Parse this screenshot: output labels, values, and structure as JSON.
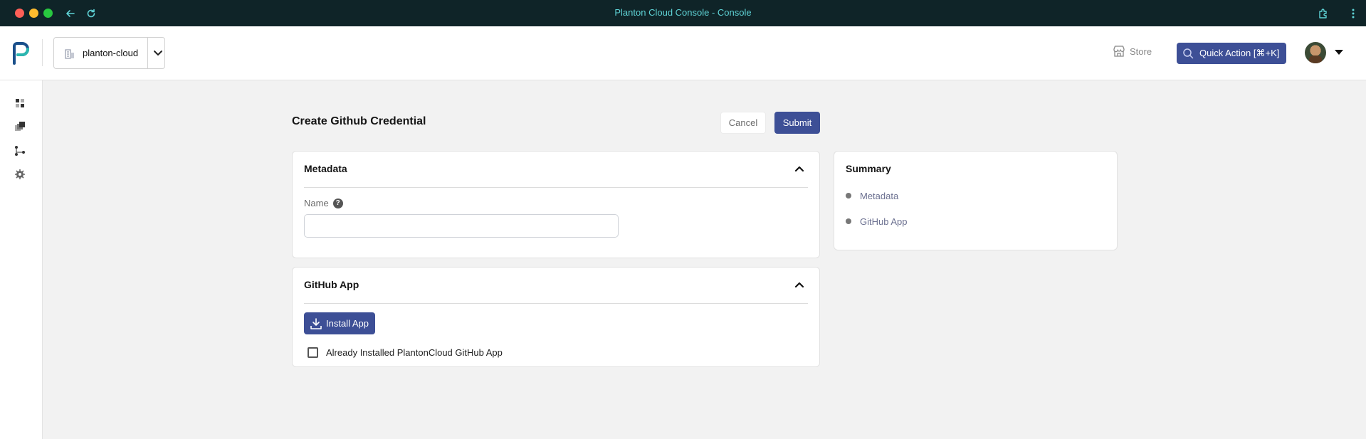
{
  "window": {
    "title": "Planton Cloud Console - Console"
  },
  "header": {
    "org_name": "planton-cloud",
    "store_label": "Store",
    "quick_action_label": "Quick Action [⌘+K]"
  },
  "sidebar": {
    "items": [
      {
        "icon": "dashboard-icon"
      },
      {
        "icon": "resources-icon"
      },
      {
        "icon": "pipeline-icon"
      },
      {
        "icon": "settings-gear-icon"
      }
    ]
  },
  "page": {
    "title": "Create Github Credential",
    "cancel_label": "Cancel",
    "submit_label": "Submit"
  },
  "metadata_section": {
    "title": "Metadata",
    "name_label": "Name",
    "help_glyph": "?",
    "name_value": "",
    "name_placeholder": ""
  },
  "github_app_section": {
    "title": "GitHub App",
    "install_label": "Install App",
    "checkbox_label": "Already Installed PlantonCloud GitHub App",
    "checkbox_checked": false
  },
  "summary": {
    "title": "Summary",
    "items": [
      {
        "label": "Metadata"
      },
      {
        "label": "GitHub App"
      }
    ]
  },
  "colors": {
    "primary": "#3d4f96",
    "titlebar": "#0f2428",
    "title_text": "#5fd3d6",
    "background": "#f2f2f2"
  }
}
